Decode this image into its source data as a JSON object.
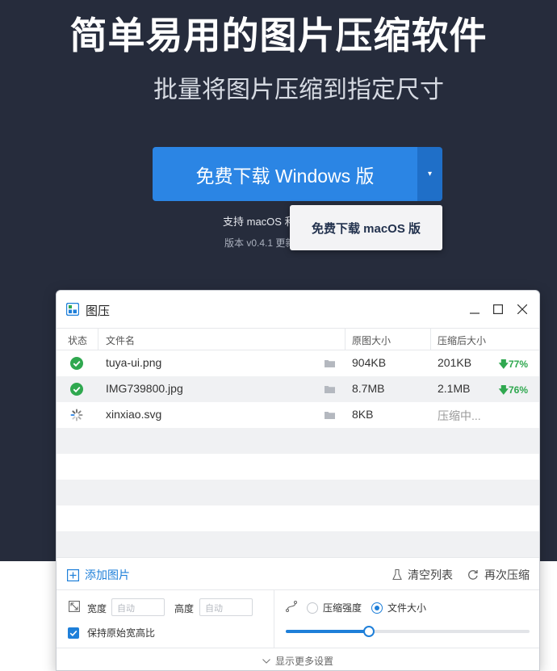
{
  "hero": {
    "title": "简单易用的图片压缩软件",
    "subtitle": "批量将图片压缩到指定尺寸",
    "download_windows": "免费下载 Windows 版",
    "dropdown_arrow": "▾",
    "support_text": "支持 macOS 和",
    "version_text": "版本 v0.4.1 更新",
    "download_mac": "免费下载 macOS 版"
  },
  "app": {
    "name": "图压",
    "columns": {
      "status": "状态",
      "filename": "文件名",
      "original": "原图大小",
      "compressed": "压缩后大小"
    },
    "files": [
      {
        "status": "done",
        "name": "tuya-ui.png",
        "original": "904KB",
        "compressed": "201KB",
        "ratio": "77%"
      },
      {
        "status": "done",
        "name": "IMG739800.jpg",
        "original": "8.7MB",
        "compressed": "2.1MB",
        "ratio": "76%"
      },
      {
        "status": "loading",
        "name": "xinxiao.svg",
        "original": "8KB",
        "compressed": "压缩中..."
      }
    ],
    "toolbar": {
      "add": "添加图片",
      "clear": "清空列表",
      "recompress": "再次压缩"
    },
    "settings": {
      "width_label": "宽度",
      "width_placeholder": "自动",
      "height_label": "高度",
      "height_placeholder": "自动",
      "keep_ratio": "保持原始宽高比",
      "mode_strength": "压缩强度",
      "mode_filesize": "文件大小",
      "slider_value": 0.34
    },
    "more_settings": "显示更多设置"
  },
  "colors": {
    "hero_bg": "#262c3c",
    "accent": "#2b85e4",
    "success": "#2fa84f"
  }
}
